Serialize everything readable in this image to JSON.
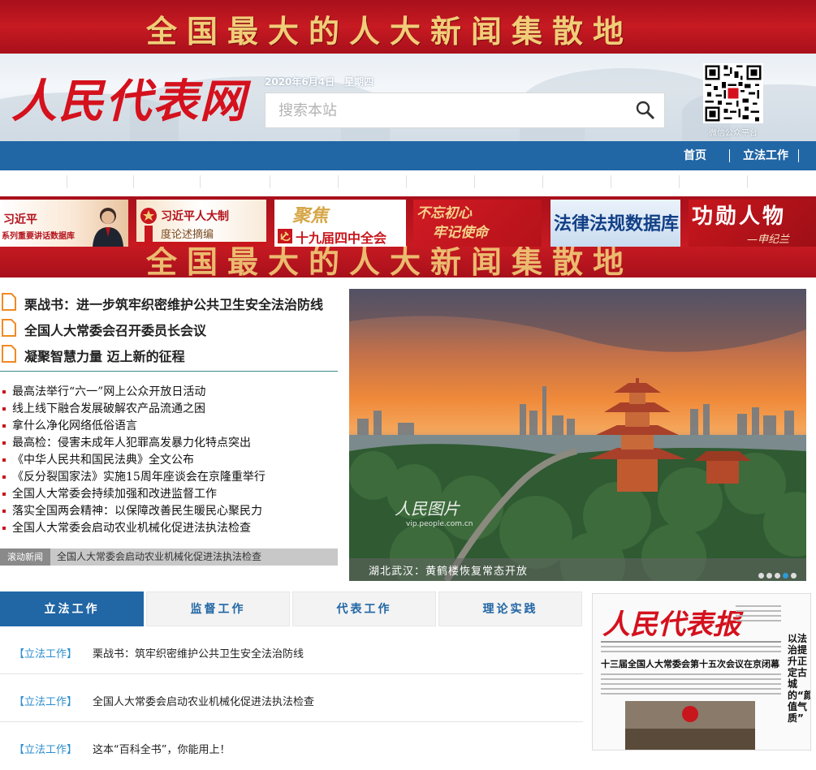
{
  "banner": {
    "slogan": "全国最大的人大新闻集散地"
  },
  "header": {
    "logo": "人民代表网",
    "date": "2020年6月4日　星期四",
    "search_placeholder": "搜索本站",
    "qr_label": "微信公众平台"
  },
  "nav": {
    "items": [
      "首页",
      "立法工作"
    ]
  },
  "features": {
    "items": [
      {
        "line1": "习近平",
        "line2": "系列重要讲话数据库"
      },
      {
        "line1": "习近平人大制",
        "line2": "度论述摘编"
      },
      {
        "line1": "聚焦",
        "line2": "十九届四中全会"
      },
      {
        "line1": "不忘初心",
        "line2": "牢记使命"
      },
      {
        "line1": "法律法规数据库"
      },
      {
        "line1": "功勋人物",
        "line2": "—申纪兰"
      }
    ]
  },
  "headlines": [
    "栗战书：进一步筑牢织密维护公共卫生安全法治防线",
    "全国人大常委会召开委员长会议",
    "凝聚智慧力量 迈上新的征程"
  ],
  "news": [
    "最高法举行“六一”网上公众开放日活动",
    "线上线下融合发展破解农产品流通之困",
    "拿什么净化网络低俗语言",
    "最高检：侵害未成年人犯罪高发暴力化特点突出",
    "《中华人民共和国民法典》全文公布",
    "《反分裂国家法》实施15周年座谈会在京隆重举行",
    "全国人大常委会持续加强和改进监督工作",
    "落实全国两会精神：以保障改善民生暖民心聚民力",
    "全国人大常委会启动农业机械化促进法执法检查"
  ],
  "scroll": {
    "label": "滚动新闻",
    "text": "全国人大常委会启动农业机械化促进法执法检查"
  },
  "photo": {
    "watermark": "人民图片",
    "watermark_url": "vip.people.com.cn",
    "caption": "湖北武汉：黄鹤楼恢复常态开放",
    "active_dot": 4,
    "dot_count": 5
  },
  "tabs": [
    "立法工作",
    "监督工作",
    "代表工作",
    "理论实践"
  ],
  "articles": [
    {
      "tag": "【立法工作】",
      "title": "栗战书：筑牢织密维护公共卫生安全法治防线"
    },
    {
      "tag": "【立法工作】",
      "title": "全国人大常委会启动农业机械化促进法执法检查"
    },
    {
      "tag": "【立法工作】",
      "title": "这本“百科全书”，你能用上！"
    }
  ],
  "paper": {
    "logo": "人民代表报",
    "headline": "十三届全国人大常委会第十五次会议在京闭幕",
    "side": "以法治提升正定古城的“颜值气质”"
  },
  "colors": {
    "brand_red": "#c71a22",
    "nav_blue": "#2166a5",
    "tag_blue": "#2b8ed0",
    "gold": "#f1cd78"
  }
}
